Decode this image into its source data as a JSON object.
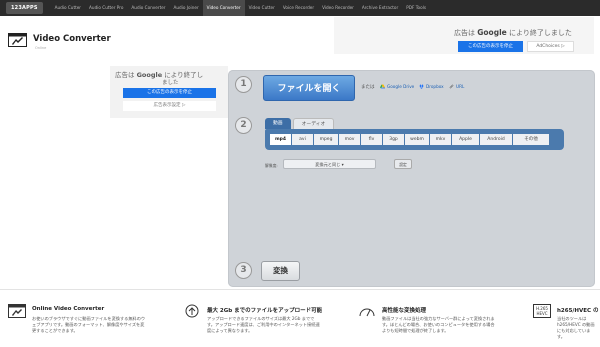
{
  "nav": {
    "brand": "123APPS",
    "links": [
      "Audio Cutter",
      "Audio Cutter Pro",
      "Audio Converter",
      "Audio Joiner",
      "Video Converter",
      "Video Cutter",
      "Voice Recorder",
      "Video Recorder",
      "Archive Extractor",
      "PDF Tools"
    ],
    "active_index": 4
  },
  "app": {
    "title": "Video Converter",
    "subtitle": "Online"
  },
  "ad_top": {
    "text_pre": "広告は ",
    "brand": "Google",
    "text_post": " により終了しました",
    "stop_label": "この広告の表示を停止",
    "choices_label": "AdChoices ▷"
  },
  "ad_left": {
    "text_pre": "広告は ",
    "brand": "Google",
    "text_post": " により終了し",
    "text_line2": "ました",
    "stop_label": "この広告の表示を停止",
    "settings_label": "広告表示設定 ▷"
  },
  "converter": {
    "step1": "1",
    "step2": "2",
    "step3": "3",
    "open_label": "ファイルを開く",
    "or_label": "または",
    "sources": [
      "Google Drive",
      "Dropbox",
      "URL"
    ],
    "tabs": [
      "動画",
      "オーディオ"
    ],
    "formats": [
      "mp4",
      "avi",
      "mpeg",
      "mov",
      "flv",
      "3gp",
      "webm",
      "mkv",
      "Apple",
      "Android",
      "その他"
    ],
    "selected_format": "mp4",
    "quality_label": "解像度:",
    "quality_value": "変換元と同じ ▾",
    "settings_label": "設定",
    "convert_label": "変換"
  },
  "features": [
    {
      "title": "Online Video Converter",
      "desc": "お使いのブラウザですぐに動画ファイルを変換する無料のウェブアプリです。動画のフォーマット、解像度やサイズを変更することができます。"
    },
    {
      "title": "最大 2Gb までのファイルをアップロード可能",
      "desc": "アップロードできるファイルのサイズは最大 2Gb までです。アップロード速度は、ご利用中のインターネット接続速度によって異なります。"
    },
    {
      "title": "高性能な変換処理",
      "desc": "動画ファイルは当社の強力なサーバー群によって変換されます。ほとんどの場合、お使いのコンピュータを使用する場合よりも短時間で処理が終了します。"
    },
    {
      "title": "h265/HVEC の",
      "desc": "当社のツールは h265/HEVC の動画にも対応しています。"
    }
  ],
  "colors": {
    "nav_bg": "#2b2b2b",
    "panel_bg": "#cfd3d8",
    "primary": "#3b78c7",
    "ad_blue": "#1a73e8"
  }
}
